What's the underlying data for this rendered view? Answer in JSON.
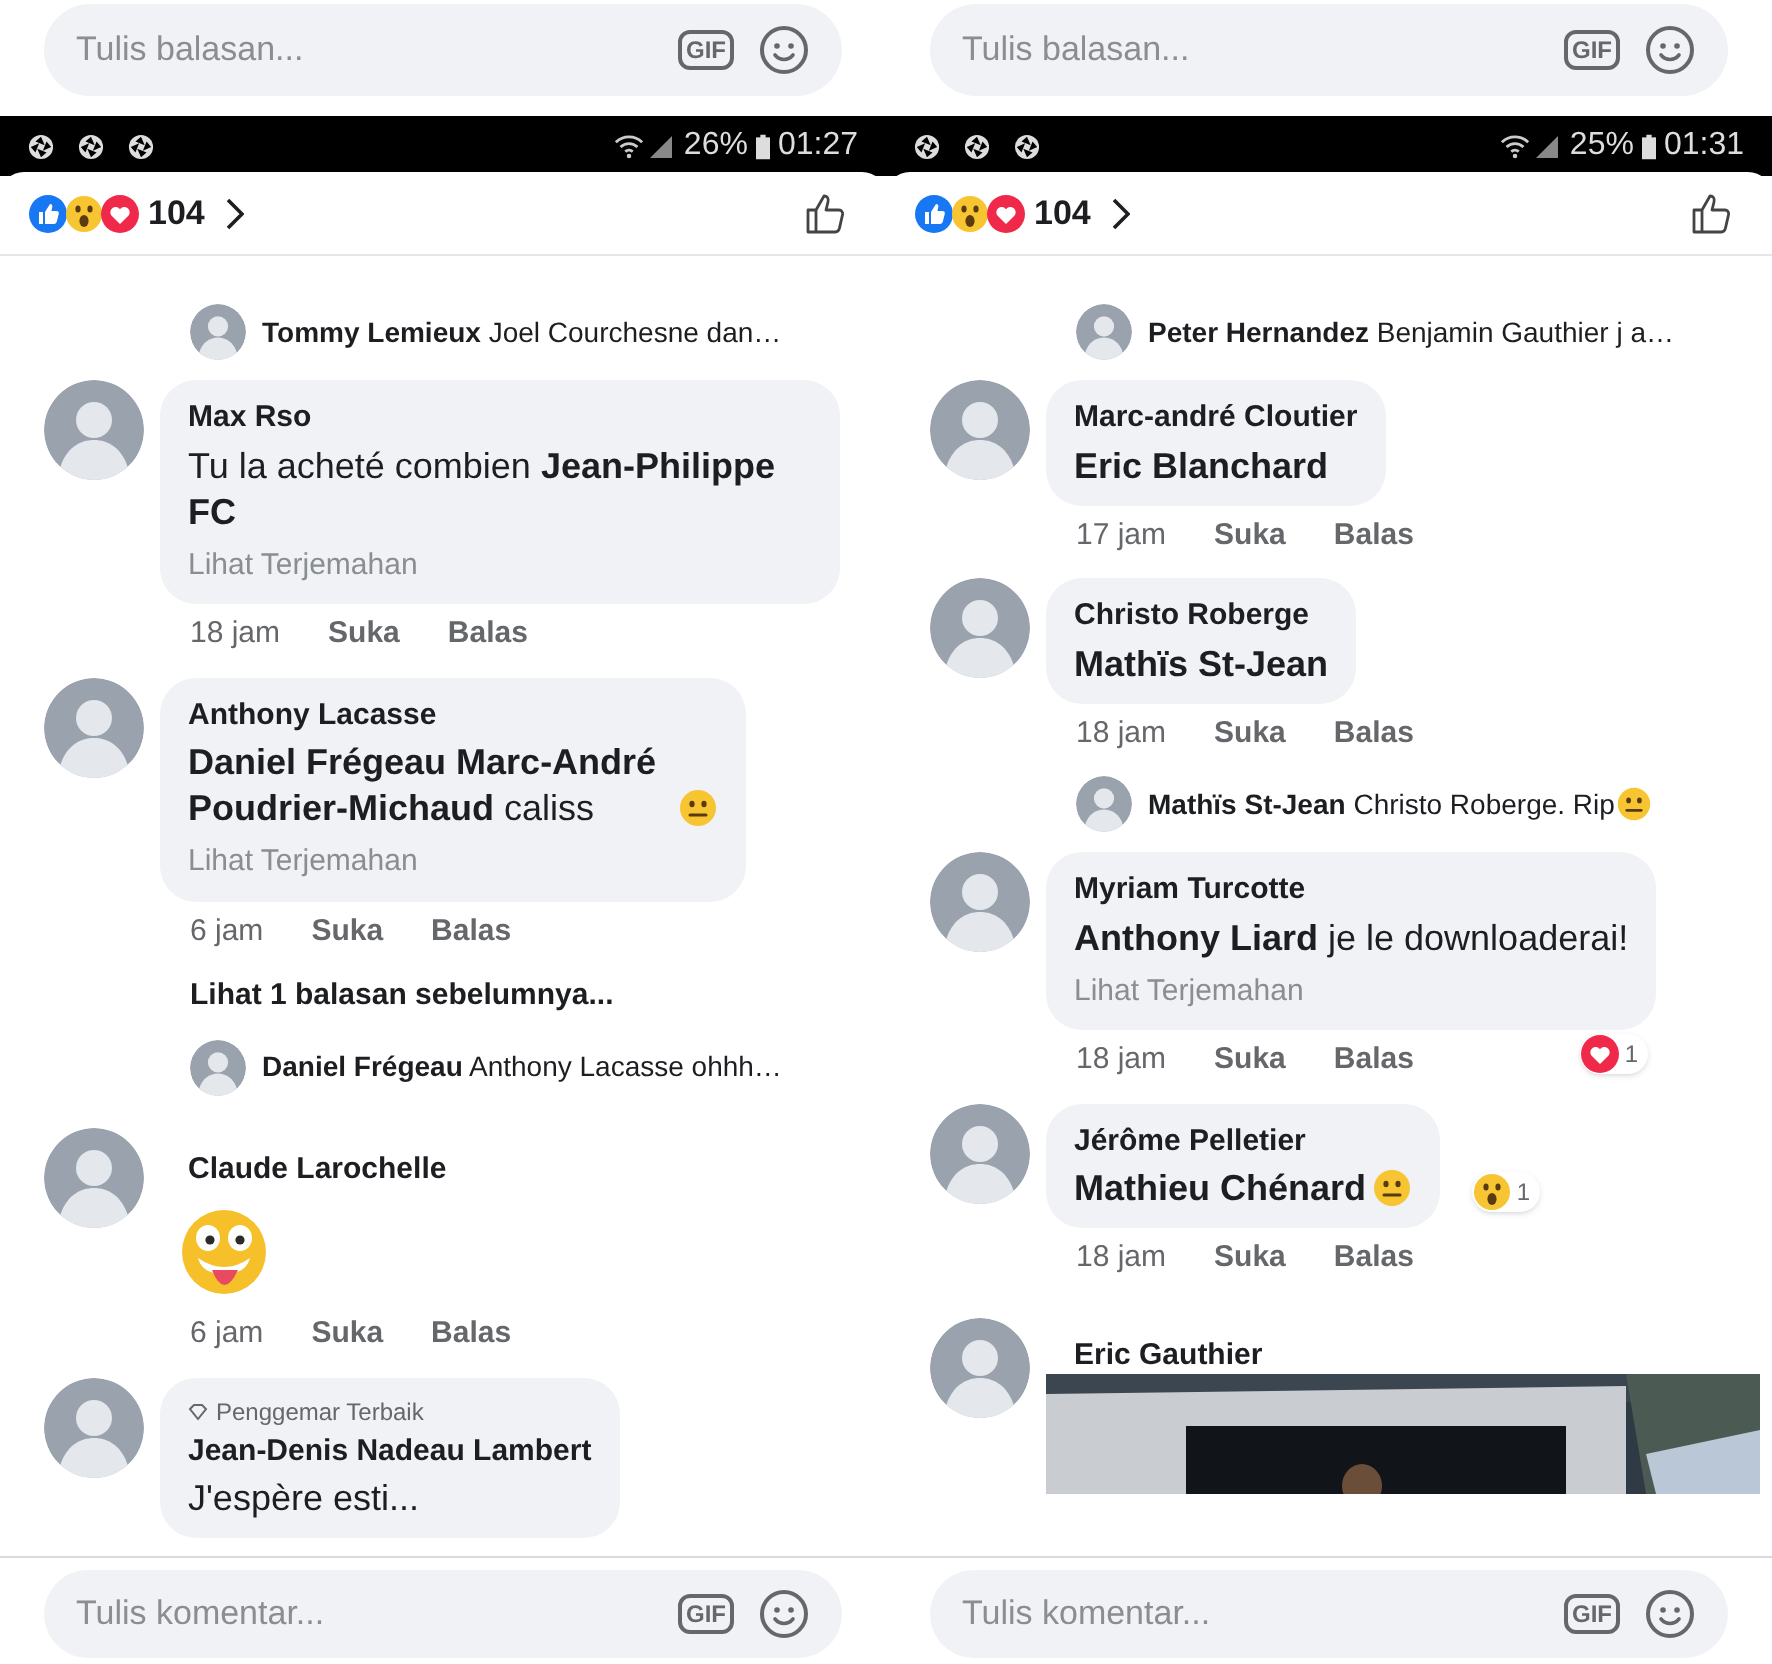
{
  "panels": [
    {
      "reply_field": {
        "placeholder": "Tulis balasan...",
        "gif_label": "GIF"
      },
      "status_bar": {
        "battery": "26%",
        "time": "01:27"
      },
      "reactions_count": "104",
      "items": [
        {
          "kind": "reply",
          "author": "Tommy Lemieux",
          "text": "Joel Courchesne dan…"
        },
        {
          "kind": "comment",
          "author": "Max Rso",
          "body": "Tu la acheté combien **Jean-Philippe FC**",
          "translate": "Lihat Terjemahan",
          "time": "18 jam",
          "like": "Suka",
          "reply": "Balas"
        },
        {
          "kind": "comment",
          "author": "Anthony Lacasse",
          "body": "**Daniel Frégeau Marc-André Poudrier-Michaud** caliss",
          "emoji": true,
          "translate": "Lihat Terjemahan",
          "time": "6 jam",
          "like": "Suka",
          "reply": "Balas"
        },
        {
          "kind": "more",
          "text": "Lihat 1 balasan sebelumnya..."
        },
        {
          "kind": "reply",
          "author": "Daniel Frégeau",
          "text": "Anthony Lacasse ohhh…"
        },
        {
          "kind": "sticker",
          "author": "Claude Larochelle",
          "time": "6 jam",
          "like": "Suka",
          "reply": "Balas"
        },
        {
          "kind": "comment",
          "badge": "Penggemar Terbaik",
          "author": "Jean-Denis Nadeau Lambert",
          "body": "J'espère esti..."
        }
      ],
      "composer": {
        "placeholder": "Tulis komentar...",
        "gif_label": "GIF"
      }
    },
    {
      "reply_field": {
        "placeholder": "Tulis balasan...",
        "gif_label": "GIF"
      },
      "status_bar": {
        "battery": "25%",
        "time": "01:31"
      },
      "reactions_count": "104",
      "items": [
        {
          "kind": "reply",
          "author": "Peter Hernandez",
          "text": "Benjamin Gauthier j a…"
        },
        {
          "kind": "comment",
          "author": "Marc-andré Cloutier",
          "body": "**Eric Blanchard**",
          "time": "17 jam",
          "like": "Suka",
          "reply": "Balas"
        },
        {
          "kind": "comment",
          "author": "Christo Roberge",
          "body": "**Mathïs St-Jean**",
          "time": "18 jam",
          "like": "Suka",
          "reply": "Balas"
        },
        {
          "kind": "reply",
          "author": "Mathïs St-Jean",
          "text": "Christo Roberge. Rip",
          "emoji": true
        },
        {
          "kind": "comment",
          "author": "Myriam Turcotte",
          "body": "**Anthony Liard** je le downloaderai!",
          "translate": "Lihat Terjemahan",
          "time": "18 jam",
          "like": "Suka",
          "reply": "Balas",
          "reaction": {
            "kind": "love",
            "count": "1"
          }
        },
        {
          "kind": "comment",
          "author": "Jérôme Pelletier",
          "body": "**Mathieu Chénard**",
          "emoji": true,
          "time": "18 jam",
          "like": "Suka",
          "reply": "Balas",
          "reaction": {
            "kind": "wow",
            "count": "1"
          }
        },
        {
          "author": "Eric Gauthier"
        }
      ],
      "composer": {
        "placeholder": "Tulis komentar...",
        "gif_label": "GIF"
      }
    }
  ]
}
